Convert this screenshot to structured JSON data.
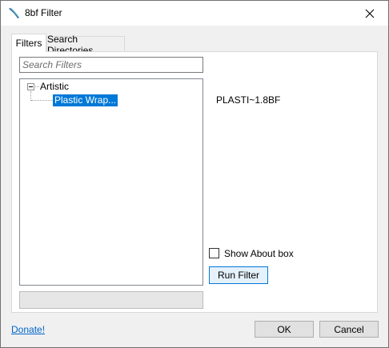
{
  "window": {
    "title": "8bf Filter"
  },
  "tabs": [
    {
      "label": "Filters",
      "active": true
    },
    {
      "label": "Search Directories",
      "active": false
    }
  ],
  "search": {
    "placeholder": "Search Filters",
    "value": ""
  },
  "tree": {
    "parent_label": "Artistic",
    "child_label": "Plastic Wrap..."
  },
  "details": {
    "filename": "PLASTI~1.8BF"
  },
  "options": {
    "show_about_label": "Show About box",
    "show_about_checked": false
  },
  "buttons": {
    "run_filter": "Run Filter",
    "ok": "OK",
    "cancel": "Cancel"
  },
  "progress": {
    "value": 0
  },
  "footer": {
    "donate_label": "Donate!"
  },
  "colors": {
    "selection": "#0078d7",
    "link": "#0066cc",
    "dialog_bg": "#f0f0f0"
  }
}
